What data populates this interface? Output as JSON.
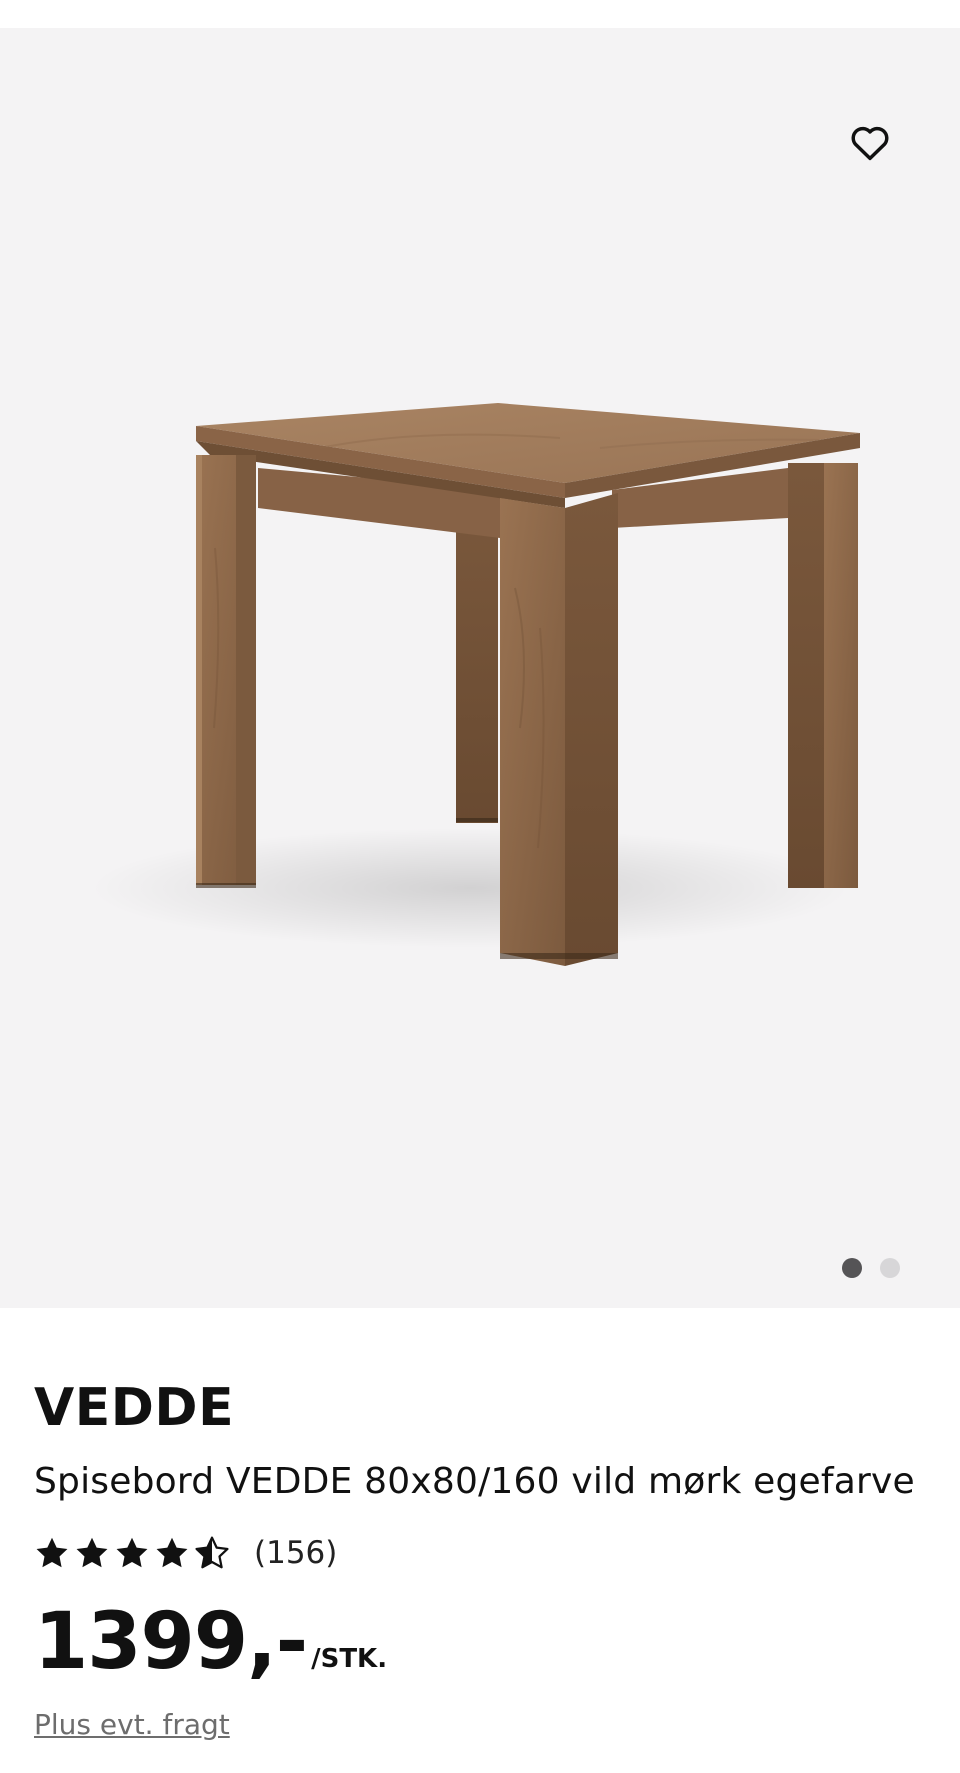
{
  "gallery": {
    "image_alt": "Spisebord VEDDE 80x80/160 vild mørk egefarve",
    "total_images": 2,
    "active_index": 0,
    "favorite_icon": "heart-outline-icon"
  },
  "product": {
    "brand": "VEDDE",
    "name": "Spisebord VEDDE 80x80/160 vild mørk egefarve",
    "rating": 4.5,
    "rating_max": 5,
    "review_count": "(156)",
    "price": "1399,-",
    "price_unit": "/STK.",
    "shipping_note": "Plus evt. fragt"
  },
  "colors": {
    "gallery_bg": "#f4f3f4",
    "text": "#111111",
    "muted": "#6d6d6d",
    "dot_active": "#555456",
    "dot_inactive": "#d7d6d8"
  }
}
